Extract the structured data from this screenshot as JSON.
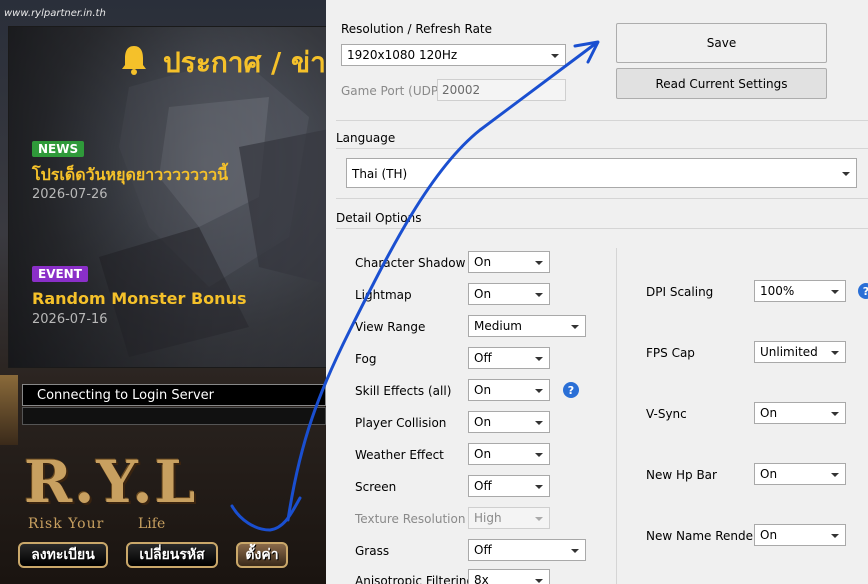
{
  "launcher": {
    "url": "www.rylpartner.in.th",
    "announce_title": "ประกาศ / ข่าว",
    "news": [
      {
        "badge": "NEWS",
        "title": "โปรเด็ดวันหยุดยาวววววววนี้",
        "date": "2026-07-26"
      },
      {
        "badge": "EVENT",
        "title": "Random Monster Bonus",
        "date": "2026-07-16"
      }
    ],
    "status": "Connecting to Login Server",
    "logo": "R.Y.L",
    "logo_sub": "Risk Your",
    "logo_sub2": "Life",
    "buttons": {
      "register": "ลงทะเบียน",
      "change_password": "เปลี่ยนรหัส",
      "settings": "ตั้งค่า"
    }
  },
  "settings": {
    "resolution_label": "Resolution / Refresh Rate",
    "resolution_value": "1920x1080 120Hz",
    "game_port_label": "Game Port (UDP)",
    "game_port_value": "20002",
    "save_label": "Save",
    "read_label": "Read Current Settings",
    "language_label": "Language",
    "language_value": "Thai (TH)",
    "detail_label": "Detail Options",
    "left_options": [
      {
        "label": "Character Shadow",
        "value": "On"
      },
      {
        "label": "Lightmap",
        "value": "On"
      },
      {
        "label": "View Range",
        "value": "Medium"
      },
      {
        "label": "Fog",
        "value": "Off"
      },
      {
        "label": "Skill Effects (all)",
        "value": "On"
      },
      {
        "label": "Player Collision",
        "value": "On"
      },
      {
        "label": "Weather Effect",
        "value": "On"
      },
      {
        "label": "Screen",
        "value": "Off"
      },
      {
        "label": "Texture Resolution",
        "value": "High"
      },
      {
        "label": "Grass",
        "value": "Off"
      },
      {
        "label": "Anisotropic Filtering",
        "value": "8x"
      }
    ],
    "right_options": [
      {
        "label": "DPI Scaling",
        "value": "100%"
      },
      {
        "label": "FPS Cap",
        "value": "Unlimited"
      },
      {
        "label": "V-Sync",
        "value": "On"
      },
      {
        "label": "New Hp Bar",
        "value": "On"
      },
      {
        "label": "New Name Render",
        "value": "On"
      }
    ],
    "help_glyph": "?"
  },
  "colors": {
    "accent_gold": "#f5c12a",
    "news_badge": "#2f9a3a",
    "event_badge": "#8a2fc8",
    "annotation_arrow": "#1a4fd0",
    "help": "#2a6fd6"
  }
}
